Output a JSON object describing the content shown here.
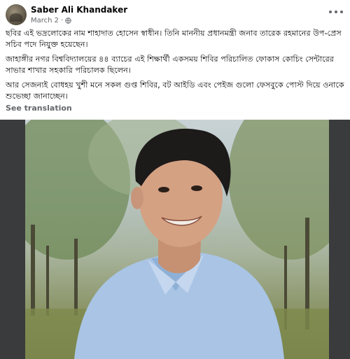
{
  "post": {
    "author": "Saber Ali Khandaker",
    "date": "March 2",
    "separator": "·",
    "privacy_icon": "globe-icon",
    "more_icon": "more-options-icon",
    "paragraphs": [
      "ছবির এই ভদ্রলোকের নাম শাহাদাত হোসেন স্বাধীন। তিনি মাননীয় প্রধানমন্ত্রী জনাব তারেক রহমানের উপ-প্রেস সচিব পদে নিযুক্ত হয়েছেন।",
      "জাহাঙ্গীর নগর বিশ্ববিদ্যালয়ের ৪৪ ব্যাচের এই শিক্ষার্থী একসময় শিবির পরিচালিত ফোকাস কোচিং সেন্টারের সাভার শাখার সহকারি পরিচালক ছিলেন।",
      "আর সেজন্যই বোধহয় খুশী মনে সকল গুপ্ত শিবির, বট আইডি এবং পেইজ গুলো ফেসবুকে পোস্ট দিয়ে ওনাকে শুভেচ্ছা জানাচ্ছেন।"
    ],
    "see_translation": "See translation"
  },
  "colors": {
    "text": "#050505",
    "secondary": "#65676b",
    "photo_frame": "#3a3b3c"
  }
}
